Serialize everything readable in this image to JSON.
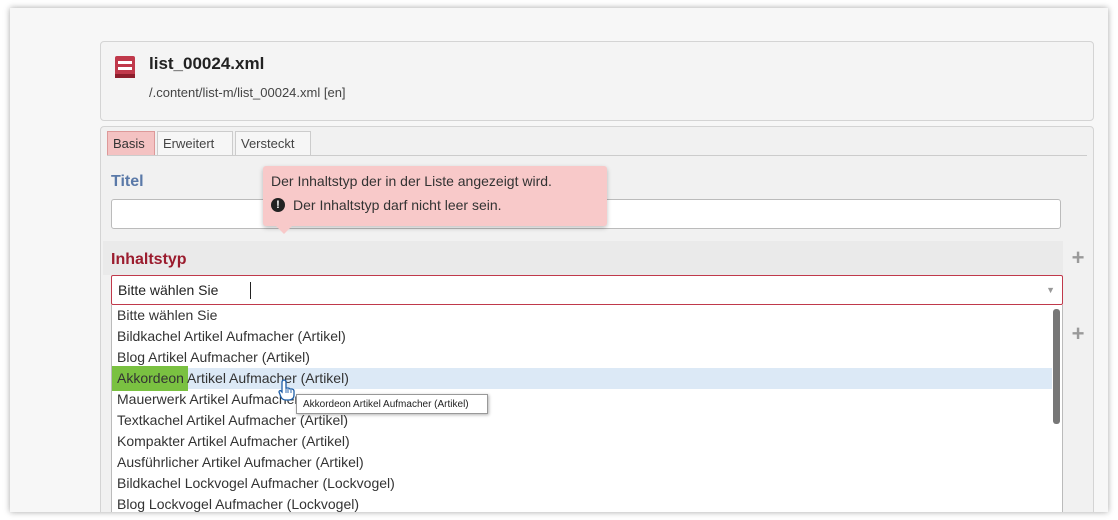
{
  "header": {
    "file_name": "list_00024.xml",
    "file_path": "/.content/list-m/list_00024.xml [en]",
    "icon": "list-file-icon"
  },
  "tabs": [
    {
      "label": "Basis",
      "active": true
    },
    {
      "label": "Erweitert",
      "active": false
    },
    {
      "label": "Versteckt",
      "active": false
    }
  ],
  "fields": {
    "titel_label": "Titel",
    "titel_value": "",
    "inhaltstyp_label": "Inhaltstyp",
    "select_value": "Bitte wählen Sie"
  },
  "error_tooltip": {
    "help": "Der Inhaltstyp der in der Liste angezeigt wird.",
    "error": "Der Inhaltstyp darf nicht leer sein.",
    "icon": "exclamation-icon"
  },
  "options": [
    "Bitte wählen Sie",
    "Bildkachel Artikel Aufmacher (Artikel)",
    "Blog Artikel Aufmacher (Artikel)",
    "Akkordeon Artikel Aufmacher (Artikel)",
    "Mauerwerk Artikel Aufmacher (Artikel)",
    "Textkachel Artikel Aufmacher (Artikel)",
    "Kompakter Artikel Aufmacher (Artikel)",
    "Ausführlicher Artikel Aufmacher (Artikel)",
    "Bildkachel Lockvogel Aufmacher (Lockvogel)",
    "Blog Lockvogel Aufmacher (Lockvogel)"
  ],
  "hovered_option_index": 3,
  "hover_tooltip": "Akkordeon Artikel Aufmacher (Artikel)",
  "colors": {
    "accent_red": "#9b1c2e",
    "active_tab": "#f4c2c2",
    "highlight_green": "#7ac141",
    "hover_row": "#dce9f6"
  }
}
